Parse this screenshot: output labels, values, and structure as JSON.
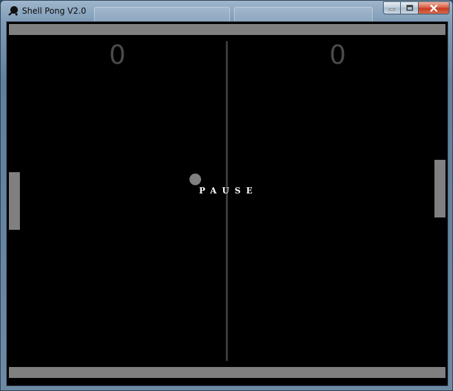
{
  "window": {
    "title": "Shell Pong V2.0",
    "icon": "ping-pong-paddle-icon",
    "controls": {
      "minimize": "minimize-icon",
      "maximize": "maximize-icon",
      "close": "close-icon"
    }
  },
  "game": {
    "score_left": "0",
    "score_right": "0",
    "status": "PAUSE",
    "colors": {
      "background": "#000000",
      "walls": "#808080",
      "paddles": "#808080",
      "ball": "#808080",
      "net": "#3c3c3c",
      "score": "#4a4a4a",
      "status_text": "#ffffff"
    }
  }
}
